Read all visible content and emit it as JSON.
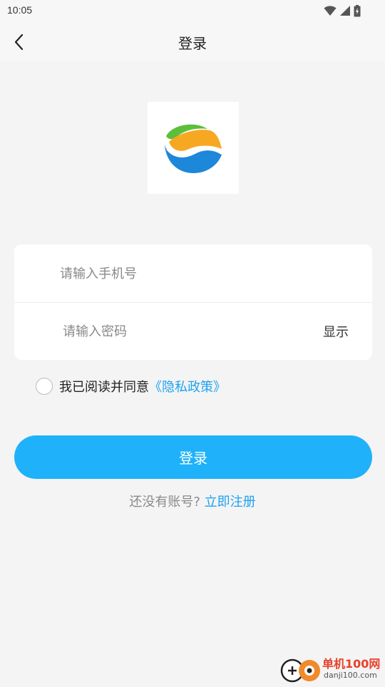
{
  "status_bar": {
    "time": "10:05",
    "icons": [
      "wifi-icon",
      "cellular-signal-icon",
      "battery-icon"
    ]
  },
  "nav": {
    "title": "登录",
    "back_icon": "chevron-left-icon"
  },
  "form": {
    "phone_placeholder": "请输入手机号",
    "password_placeholder": "请输入密码",
    "show_password_label": "显示"
  },
  "agreement": {
    "text": "我已阅读并同意",
    "link": "《隐私政策》",
    "checked": false
  },
  "login_button_label": "登录",
  "register": {
    "prompt": "还没有账号?",
    "link": "立即注册"
  },
  "watermark": {
    "name": "单机100网",
    "domain": "danji100.com"
  },
  "colors": {
    "accent": "#1fb2fa",
    "link": "#1ea2f0",
    "background": "#f4f4f4",
    "logo_green": "#5cbf3a",
    "logo_orange": "#f7a823",
    "logo_blue": "#1d87d9",
    "watermark_red": "#e8412a"
  }
}
